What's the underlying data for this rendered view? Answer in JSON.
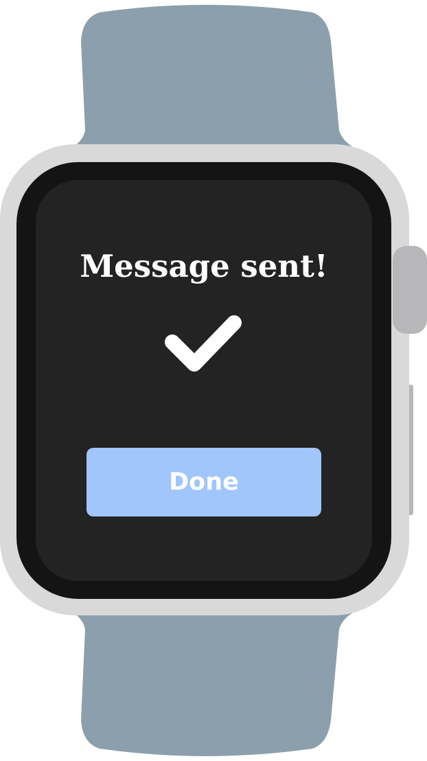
{
  "screen": {
    "title": "Message sent!",
    "status_icon": "checkmark-icon",
    "done_label": "Done"
  },
  "colors": {
    "band": "#8c9fac",
    "case": "#d9d9d9",
    "bezel": "#141414",
    "screen": "#232323",
    "button": "#a0c6fb",
    "text": "#ffffff",
    "crown": "#b7b7b9"
  }
}
